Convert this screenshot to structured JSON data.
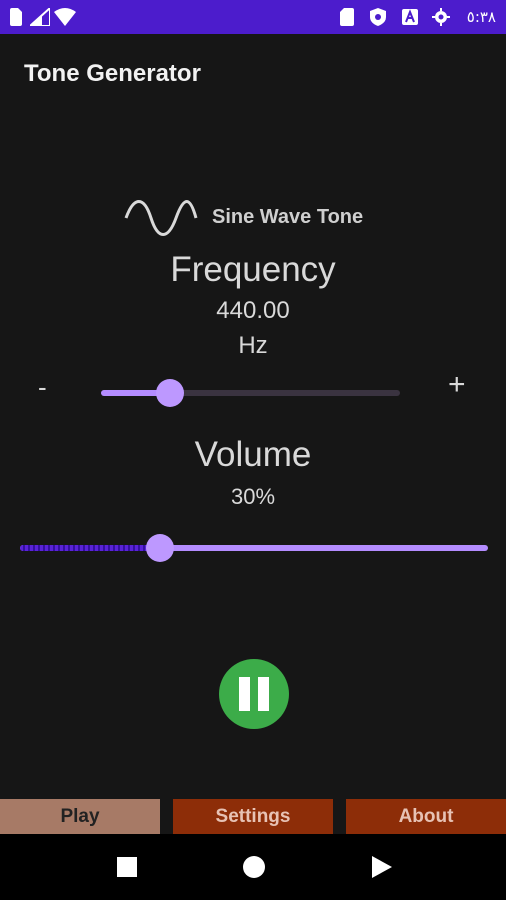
{
  "status_bar": {
    "time": "٥:٣٨",
    "bg_color": "#4c1ccc",
    "left_icons": [
      "sim-icon",
      "signal-icon",
      "wifi-icon"
    ],
    "right_icons": [
      "sd-card-icon",
      "shield-icon",
      "a-box-icon",
      "gear-icon"
    ]
  },
  "app": {
    "title": "Tone Generator"
  },
  "waveform": {
    "label": "Sine Wave Tone",
    "icon": "sine-wave-icon"
  },
  "frequency": {
    "title": "Frequency",
    "value": "440.00",
    "unit": "Hz",
    "decrease_label": "-",
    "increase_label": "+",
    "slider_level": 0.23
  },
  "volume": {
    "title": "Volume",
    "value": "30%",
    "slider_level": 0.3
  },
  "player": {
    "state": "playing",
    "button_icon": "pause-icon",
    "button_color": "#3cac49"
  },
  "tabs": [
    {
      "label": "Play",
      "active": true
    },
    {
      "label": "Settings",
      "active": false
    },
    {
      "label": "About",
      "active": false
    }
  ],
  "nav_bar": {
    "buttons": [
      "recents-square-icon",
      "home-circle-icon",
      "back-triangle-icon"
    ]
  },
  "colors": {
    "accent": "#b48cff",
    "tab_active": "#a77a66",
    "tab_inactive": "#8d2d08"
  }
}
